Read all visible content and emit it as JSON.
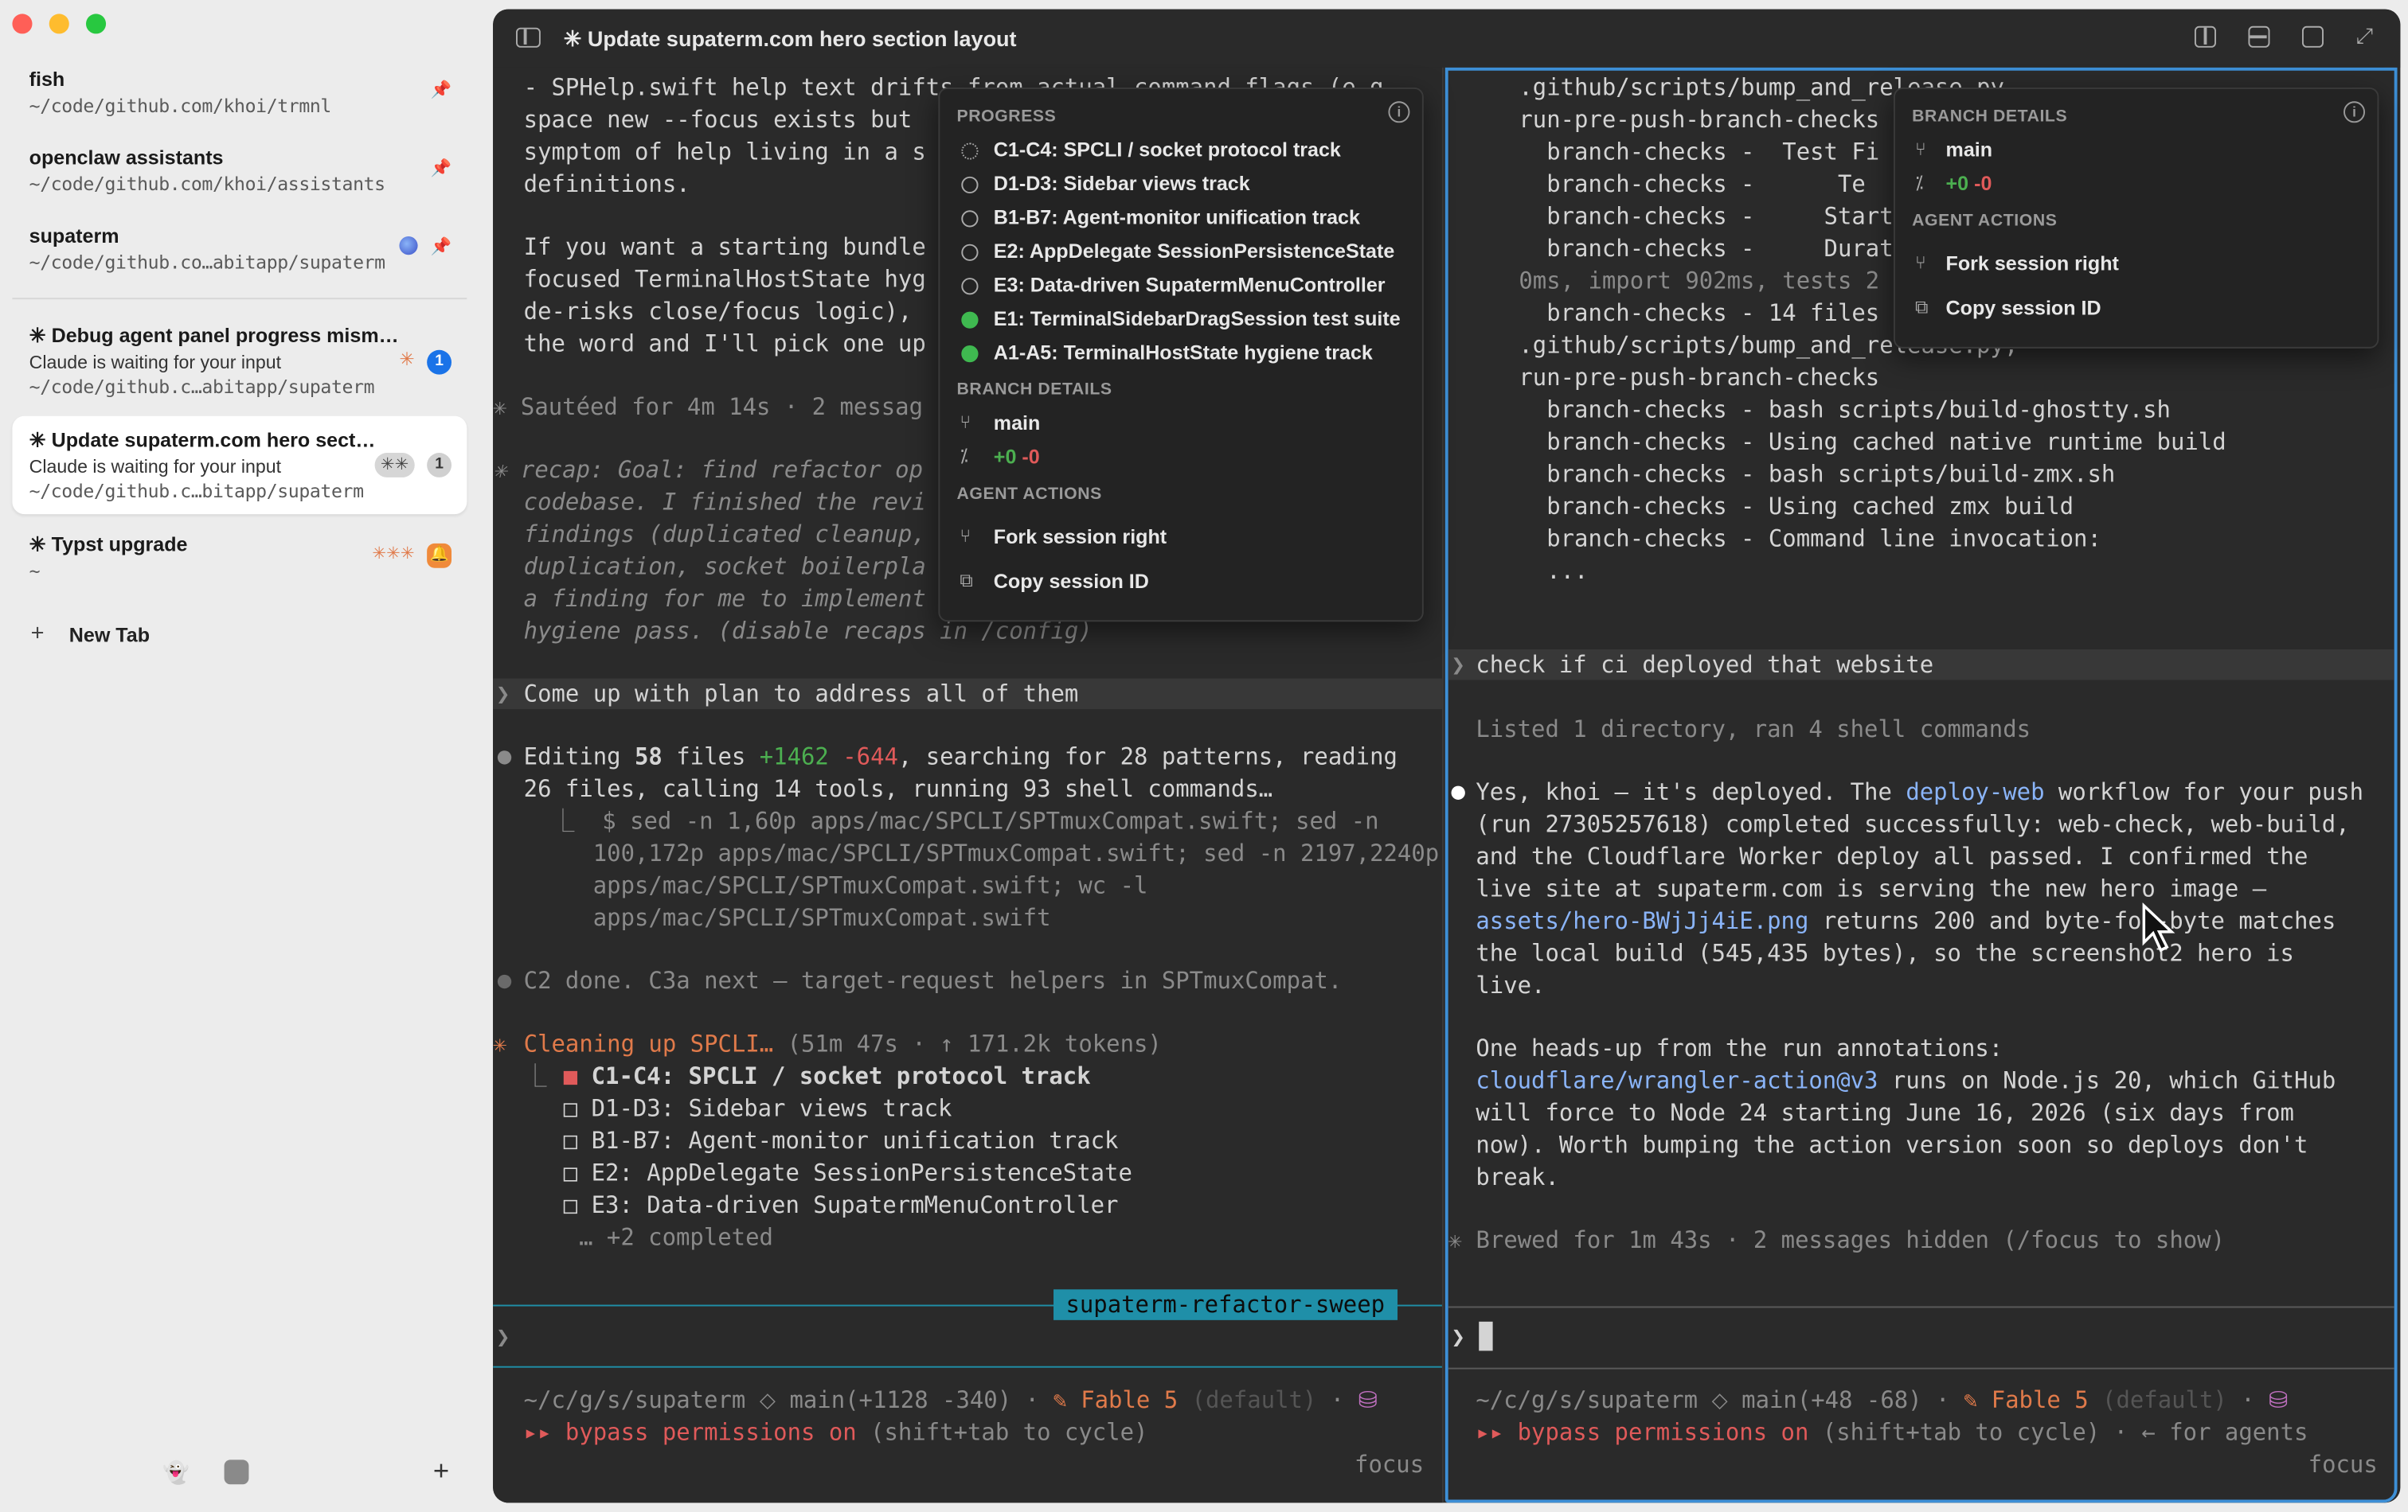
{
  "sidebar": {
    "items": [
      {
        "title": "fish",
        "path": "~/code/github.com/khoi/trmnl"
      },
      {
        "title": "openclaw assistants",
        "path": "~/code/github.com/khoi/assistants"
      },
      {
        "title": "supaterm",
        "path": "~/code/github.co…abitapp/supaterm"
      },
      {
        "title": "✳ Debug agent panel progress mism…",
        "status": "Claude is waiting for your input",
        "path": "~/code/github.c…abitapp/supaterm",
        "badge": "1"
      },
      {
        "title": "✳ Update supaterm.com hero sect…",
        "status": "Claude is waiting for your input",
        "path": "~/code/github.c…bitapp/supaterm",
        "badge": "1"
      },
      {
        "title": "✳ Typst upgrade",
        "path": "~"
      }
    ],
    "new_tab": "New Tab",
    "plus": "+"
  },
  "window": {
    "title": "✳ Update supaterm.com hero section layout"
  },
  "left_pane": {
    "lines": [
      "- SPHelp.swift help text drifts from actual command flags (e.g.,",
      "space new --focus exists but",
      "symptom of help living in a s",
      "definitions.",
      "",
      "If you want a starting bundle",
      "focused TerminalHostState hyg",
      "de-risks close/focus logic),",
      "the word and I'll pick one up",
      "",
      "✳ Sautéed for 4m 14s · 2 messag",
      "",
      "✳ recap: Goal: find refactor op",
      "codebase. I finished the revi",
      "findings (duplicated cleanup,",
      "duplication, socket boilerpla",
      "a finding for me to implement",
      "hygiene pass. (disable recaps in /config)"
    ],
    "user_prompt": "Come up with plan to address all of them",
    "editing_prefix": "Editing ",
    "editing_files": "58",
    "editing_mid": " files ",
    "editing_add": "+1462",
    "editing_del": " -644",
    "editing_rest": ", searching for 28 patterns, reading",
    "editing_line2": "26 files, calling 14 tools, running 93 shell commands…",
    "cmd_lines": [
      "  ⎿  $ sed -n 1,60p apps/mac/SPCLI/SPTmuxCompat.swift; sed -n",
      "     100,172p apps/mac/SPCLI/SPTmuxCompat.swift; sed -n 2197,2240p",
      "     apps/mac/SPCLI/SPTmuxCompat.swift; wc -l",
      "     apps/mac/SPCLI/SPTmuxCompat.swift"
    ],
    "c2_done": "C2 done. C3a next — target-request helpers in SPTmuxCompat.",
    "cleaning": "Cleaning up SPCLI…",
    "cleaning_meta": " (51m 47s · ↑ 171.2k tokens)",
    "tasks": [
      {
        "mark": "■",
        "label": "C1-C4: SPCLI / socket protocol track",
        "active": true
      },
      {
        "mark": "□",
        "label": "D1-D3: Sidebar views track",
        "active": false
      },
      {
        "mark": "□",
        "label": "B1-B7: Agent-monitor unification track",
        "active": false
      },
      {
        "mark": "□",
        "label": "E2: AppDelegate SessionPersistenceState",
        "active": false
      },
      {
        "mark": "□",
        "label": "E3: Data-driven SupatermMenuController",
        "active": false
      }
    ],
    "completed": "… +2 completed",
    "branch_tag": "supaterm-refactor-sweep",
    "prompt_char": "❯",
    "status_path": "~/c/g/s/supaterm",
    "status_branch": "main(+1128 -340)",
    "status_model": "Fable 5",
    "status_default": "(default)",
    "bypass": "bypass permissions on",
    "bypass_hint": " (shift+tab to cycle)",
    "focus": "focus"
  },
  "right_pane": {
    "lines": [
      ".github/scripts/bump_and_release.py",
      "run-pre-push-branch-checks",
      "  branch-checks -  Test Fi",
      "  branch-checks -      Te",
      "  branch-checks -     Start",
      "  branch-checks -     Durat",
      "0ms, import 902ms, tests 2",
      "  branch-checks - 14 files",
      ".github/scripts/bump_and_release.py,",
      "run-pre-push-branch-checks",
      "  branch-checks - bash scripts/build-ghostty.sh",
      "  branch-checks - Using cached native runtime build",
      "  branch-checks - bash scripts/build-zmx.sh",
      "  branch-checks - Using cached zmx build",
      "  branch-checks - Command line invocation:",
      "  ..."
    ],
    "user_prompt": "check if ci deployed that website",
    "listed": "Listed 1 directory, ran 4 shell commands",
    "answer": [
      "Yes, khoi — it's deployed. The deploy-web workflow for your push",
      "(run 27305257618) completed successfully: web-check, web-build,",
      "and the Cloudflare Worker deploy all passed. I confirmed the",
      "live site at supaterm.com is serving the new hero image —",
      "assets/hero-BWjJj4iE.png returns 200 and byte-for-byte matches",
      "the local build (545,435 bytes), so the screenshot2 hero is",
      "live.",
      "",
      "One heads-up from the run annotations:",
      "cloudflare/wrangler-action@v3 runs on Node.js 20, which GitHub",
      "will force to Node 24 starting June 16, 2026 (six days from",
      "now). Worth bumping the action version soon so deploys don't",
      "break."
    ],
    "brewed": "✳ Brewed for 1m 43s · 2 messages hidden (/focus to show)",
    "prompt_char": "❯",
    "status_path": "~/c/g/s/supaterm",
    "status_branch": "main(+48 -68)",
    "status_model": "Fable 5",
    "status_default": "(default)",
    "bypass": "bypass permissions on",
    "bypass_hint": " (shift+tab to cycle) · ← for agents",
    "focus": "focus"
  },
  "progress_popover": {
    "header": "PROGRESS",
    "items": [
      {
        "label": "C1-C4: SPCLI / socket protocol track",
        "state": "in-progress"
      },
      {
        "label": "D1-D3: Sidebar views track",
        "state": "todo"
      },
      {
        "label": "B1-B7: Agent-monitor unification track",
        "state": "todo"
      },
      {
        "label": "E2: AppDelegate SessionPersistenceState",
        "state": "todo"
      },
      {
        "label": "E3: Data-driven SupatermMenuController",
        "state": "todo"
      },
      {
        "label": "E1: TerminalSidebarDragSession test suite",
        "state": "done"
      },
      {
        "label": "A1-A5: TerminalHostState hygiene track",
        "state": "done"
      }
    ],
    "branch_header": "BRANCH DETAILS",
    "branch": "main",
    "diff_add": "+0",
    "diff_del": "-0",
    "actions_header": "AGENT ACTIONS",
    "fork": "Fork session right",
    "copy": "Copy session ID"
  },
  "right_popover": {
    "branch_header": "BRANCH DETAILS",
    "branch": "main",
    "diff_add": "+0",
    "diff_del": "-0",
    "actions_header": "AGENT ACTIONS",
    "fork": "Fork session right",
    "copy": "Copy session ID"
  },
  "colors": {
    "accent_border": "#3d8fd6",
    "branch_tag_bg": "#1f8fa8",
    "green": "#4caf50",
    "red": "#e05a5a",
    "orange": "#e07a4a"
  }
}
